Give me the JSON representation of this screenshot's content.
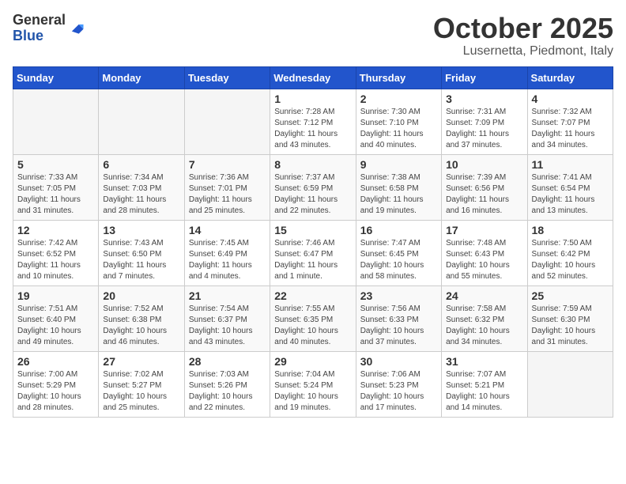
{
  "header": {
    "logo_general": "General",
    "logo_blue": "Blue",
    "month": "October 2025",
    "location": "Lusernetta, Piedmont, Italy"
  },
  "days_of_week": [
    "Sunday",
    "Monday",
    "Tuesday",
    "Wednesday",
    "Thursday",
    "Friday",
    "Saturday"
  ],
  "weeks": [
    [
      {
        "day": "",
        "info": ""
      },
      {
        "day": "",
        "info": ""
      },
      {
        "day": "",
        "info": ""
      },
      {
        "day": "1",
        "info": "Sunrise: 7:28 AM\nSunset: 7:12 PM\nDaylight: 11 hours and 43 minutes."
      },
      {
        "day": "2",
        "info": "Sunrise: 7:30 AM\nSunset: 7:10 PM\nDaylight: 11 hours and 40 minutes."
      },
      {
        "day": "3",
        "info": "Sunrise: 7:31 AM\nSunset: 7:09 PM\nDaylight: 11 hours and 37 minutes."
      },
      {
        "day": "4",
        "info": "Sunrise: 7:32 AM\nSunset: 7:07 PM\nDaylight: 11 hours and 34 minutes."
      }
    ],
    [
      {
        "day": "5",
        "info": "Sunrise: 7:33 AM\nSunset: 7:05 PM\nDaylight: 11 hours and 31 minutes."
      },
      {
        "day": "6",
        "info": "Sunrise: 7:34 AM\nSunset: 7:03 PM\nDaylight: 11 hours and 28 minutes."
      },
      {
        "day": "7",
        "info": "Sunrise: 7:36 AM\nSunset: 7:01 PM\nDaylight: 11 hours and 25 minutes."
      },
      {
        "day": "8",
        "info": "Sunrise: 7:37 AM\nSunset: 6:59 PM\nDaylight: 11 hours and 22 minutes."
      },
      {
        "day": "9",
        "info": "Sunrise: 7:38 AM\nSunset: 6:58 PM\nDaylight: 11 hours and 19 minutes."
      },
      {
        "day": "10",
        "info": "Sunrise: 7:39 AM\nSunset: 6:56 PM\nDaylight: 11 hours and 16 minutes."
      },
      {
        "day": "11",
        "info": "Sunrise: 7:41 AM\nSunset: 6:54 PM\nDaylight: 11 hours and 13 minutes."
      }
    ],
    [
      {
        "day": "12",
        "info": "Sunrise: 7:42 AM\nSunset: 6:52 PM\nDaylight: 11 hours and 10 minutes."
      },
      {
        "day": "13",
        "info": "Sunrise: 7:43 AM\nSunset: 6:50 PM\nDaylight: 11 hours and 7 minutes."
      },
      {
        "day": "14",
        "info": "Sunrise: 7:45 AM\nSunset: 6:49 PM\nDaylight: 11 hours and 4 minutes."
      },
      {
        "day": "15",
        "info": "Sunrise: 7:46 AM\nSunset: 6:47 PM\nDaylight: 11 hours and 1 minute."
      },
      {
        "day": "16",
        "info": "Sunrise: 7:47 AM\nSunset: 6:45 PM\nDaylight: 10 hours and 58 minutes."
      },
      {
        "day": "17",
        "info": "Sunrise: 7:48 AM\nSunset: 6:43 PM\nDaylight: 10 hours and 55 minutes."
      },
      {
        "day": "18",
        "info": "Sunrise: 7:50 AM\nSunset: 6:42 PM\nDaylight: 10 hours and 52 minutes."
      }
    ],
    [
      {
        "day": "19",
        "info": "Sunrise: 7:51 AM\nSunset: 6:40 PM\nDaylight: 10 hours and 49 minutes."
      },
      {
        "day": "20",
        "info": "Sunrise: 7:52 AM\nSunset: 6:38 PM\nDaylight: 10 hours and 46 minutes."
      },
      {
        "day": "21",
        "info": "Sunrise: 7:54 AM\nSunset: 6:37 PM\nDaylight: 10 hours and 43 minutes."
      },
      {
        "day": "22",
        "info": "Sunrise: 7:55 AM\nSunset: 6:35 PM\nDaylight: 10 hours and 40 minutes."
      },
      {
        "day": "23",
        "info": "Sunrise: 7:56 AM\nSunset: 6:33 PM\nDaylight: 10 hours and 37 minutes."
      },
      {
        "day": "24",
        "info": "Sunrise: 7:58 AM\nSunset: 6:32 PM\nDaylight: 10 hours and 34 minutes."
      },
      {
        "day": "25",
        "info": "Sunrise: 7:59 AM\nSunset: 6:30 PM\nDaylight: 10 hours and 31 minutes."
      }
    ],
    [
      {
        "day": "26",
        "info": "Sunrise: 7:00 AM\nSunset: 5:29 PM\nDaylight: 10 hours and 28 minutes."
      },
      {
        "day": "27",
        "info": "Sunrise: 7:02 AM\nSunset: 5:27 PM\nDaylight: 10 hours and 25 minutes."
      },
      {
        "day": "28",
        "info": "Sunrise: 7:03 AM\nSunset: 5:26 PM\nDaylight: 10 hours and 22 minutes."
      },
      {
        "day": "29",
        "info": "Sunrise: 7:04 AM\nSunset: 5:24 PM\nDaylight: 10 hours and 19 minutes."
      },
      {
        "day": "30",
        "info": "Sunrise: 7:06 AM\nSunset: 5:23 PM\nDaylight: 10 hours and 17 minutes."
      },
      {
        "day": "31",
        "info": "Sunrise: 7:07 AM\nSunset: 5:21 PM\nDaylight: 10 hours and 14 minutes."
      },
      {
        "day": "",
        "info": ""
      }
    ]
  ]
}
